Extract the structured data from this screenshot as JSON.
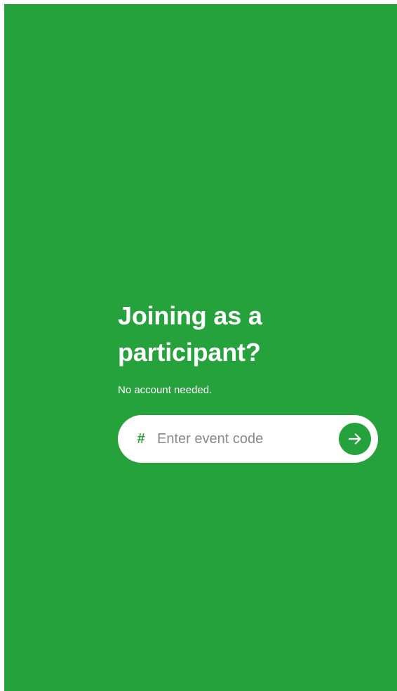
{
  "hero": {
    "title_line1": "Joining as a",
    "title_line2": "participant?",
    "subtitle": "No account needed."
  },
  "event_code_form": {
    "prefix_symbol": "#",
    "placeholder": "Enter event code",
    "value": "",
    "submit_icon": "arrow-right-icon"
  },
  "colors": {
    "background": "#25a23c",
    "accent": "#25a23c",
    "text_on_background": "#ffffff",
    "input_background": "#ffffff"
  }
}
